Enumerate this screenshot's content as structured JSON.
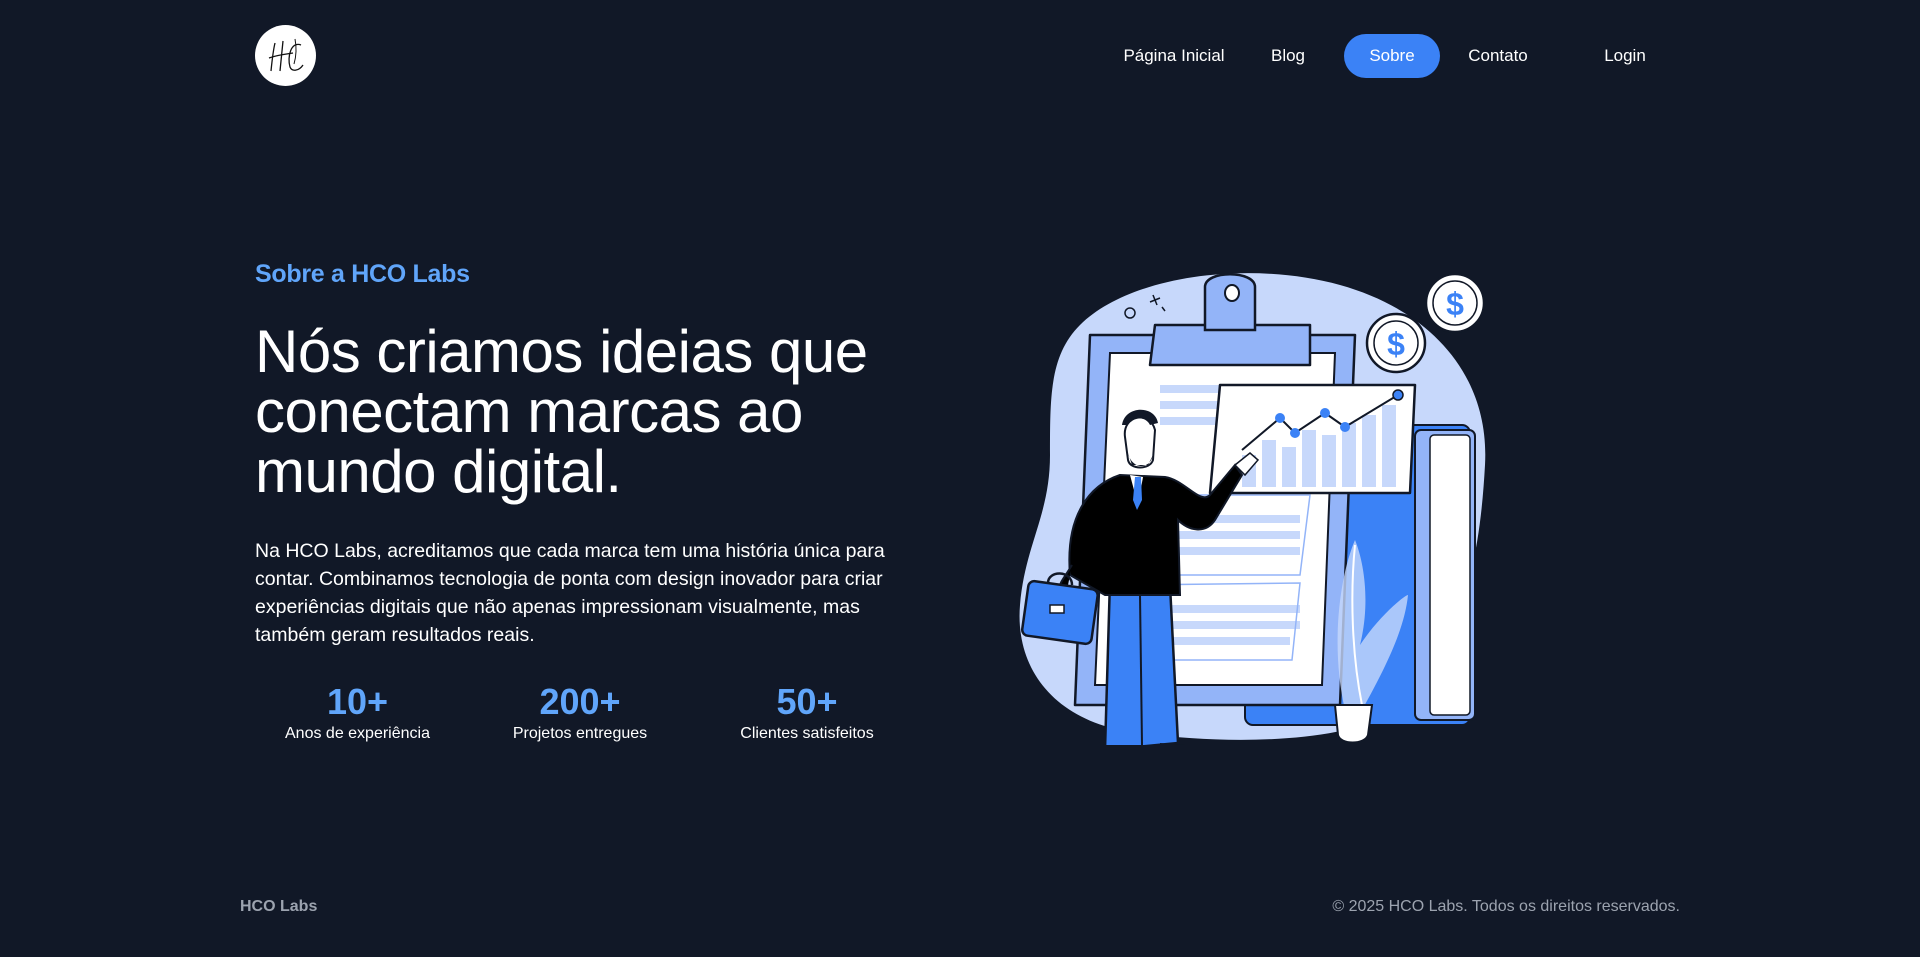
{
  "header": {
    "logo_text": "HC",
    "nav": [
      {
        "label": "Página Inicial"
      },
      {
        "label": "Blog"
      },
      {
        "label": "Sobre"
      },
      {
        "label": "Contato"
      },
      {
        "label": "Login"
      }
    ],
    "active_nav": "Sobre"
  },
  "hero": {
    "eyebrow": "Sobre a HCO Labs",
    "headline": "Nós criamos ideias que conectam marcas ao mundo digital.",
    "lead": "Na HCO Labs, acreditamos que cada marca tem uma história única para contar. Combinamos tecnologia de ponta com design inovador para criar experiências digitais que não apenas impressionam visualmente, mas também geram resultados reais.",
    "stats": [
      {
        "value": "10+",
        "label": "Anos de experiência"
      },
      {
        "value": "200+",
        "label": "Projetos entregues"
      },
      {
        "value": "50+",
        "label": "Clientes satisfeitos"
      }
    ]
  },
  "illustration": {
    "icon": "businessman-presenting-chart-illustration",
    "coin_symbol": "$"
  },
  "footer": {
    "brand": "HCO Labs",
    "copyright": "© 2025 HCO Labs. Todos os direitos reservados."
  },
  "colors": {
    "background": "#111827",
    "accent": "#3b82f6",
    "accent_light": "#60a5fa",
    "muted": "#9ca3af"
  }
}
